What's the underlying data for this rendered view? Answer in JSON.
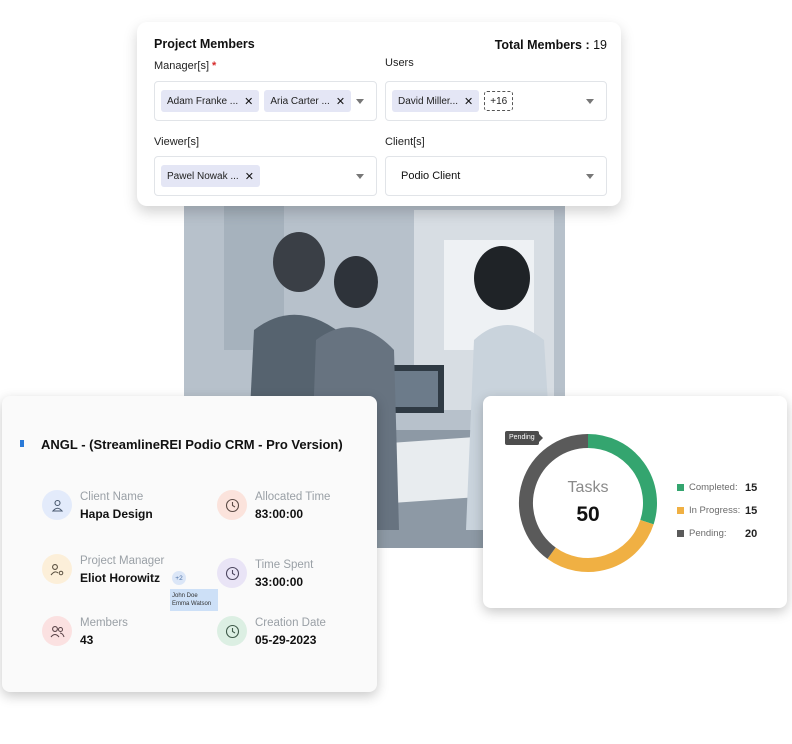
{
  "members": {
    "title": "Project Members",
    "total_label": "Total Members :",
    "total_value": "19",
    "managers": {
      "label": "Manager[s]",
      "required_mark": "*",
      "chips": [
        "Adam Franke ...",
        "Aria Carter ..."
      ]
    },
    "users": {
      "label": "Users",
      "chips": [
        "David Miller..."
      ],
      "more": "+16"
    },
    "viewers": {
      "label": "Viewer[s]",
      "chips": [
        "Pawel Nowak ..."
      ]
    },
    "clients": {
      "label": "Client[s]",
      "value": "Podio Client"
    },
    "chip_remove_glyph": "✕"
  },
  "project": {
    "title": "ANGL - (StreamlineREI Podio CRM - Pro Version)",
    "client_name": {
      "label": "Client Name",
      "value": "Hapa Design",
      "icon": "user-icon",
      "color": "#e3ebfb"
    },
    "allocated_time": {
      "label": "Allocated Time",
      "value": "83:00:00",
      "icon": "clock-icon",
      "color": "#fbe3dc"
    },
    "project_manager": {
      "label": "Project Manager",
      "value": "Eliot Horowitz",
      "icon": "user-gear-icon",
      "color": "#fcefd9"
    },
    "time_spent": {
      "label": "Time Spent",
      "value": "33:00:00",
      "icon": "clock-icon",
      "color": "#e9e4f6"
    },
    "members": {
      "label": "Members",
      "value": "43",
      "icon": "users-icon",
      "color": "#fbe1e1"
    },
    "creation_date": {
      "label": "Creation Date",
      "value": "05-29-2023",
      "icon": "clock-icon",
      "color": "#dcefe3"
    },
    "extra_badge": "+2",
    "extra_names": [
      "John Doe",
      "Emma Watson"
    ]
  },
  "tasks": {
    "title": "Tasks",
    "total": "50",
    "tooltip": "Pending",
    "chart_data": {
      "type": "pie",
      "categories": [
        "Completed:",
        "In Progress:",
        "Pending:"
      ],
      "values": [
        15,
        15,
        20
      ],
      "colors": [
        "#34a56f",
        "#f0b043",
        "#5a5a5a"
      ],
      "legend": "right"
    }
  }
}
